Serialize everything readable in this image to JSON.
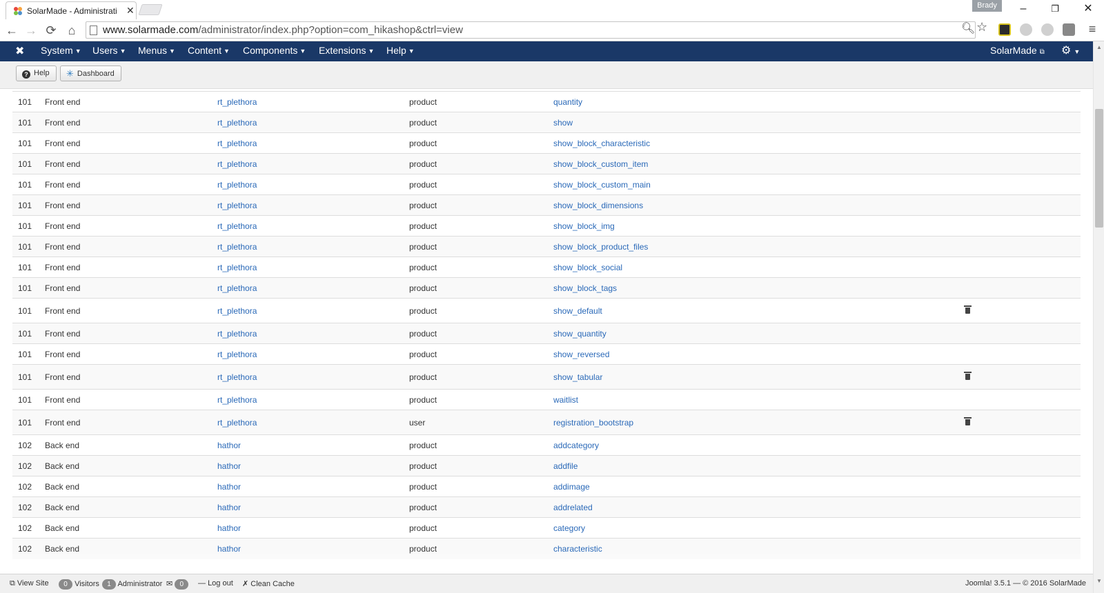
{
  "browser": {
    "tab_title": "SolarMade - Administratio",
    "profile_name": "Brady",
    "url_host": "www.solarmade.com",
    "url_path": "/administrator/index.php?option=com_hikashop&ctrl=view"
  },
  "adminbar": {
    "menu": [
      {
        "label": "System"
      },
      {
        "label": "Users"
      },
      {
        "label": "Menus"
      },
      {
        "label": "Content"
      },
      {
        "label": "Components"
      },
      {
        "label": "Extensions"
      },
      {
        "label": "Help"
      }
    ],
    "site_name": "SolarMade",
    "bg_color": "#1a3867"
  },
  "toolbar": {
    "help_label": "Help",
    "dashboard_label": "Dashboard"
  },
  "table": {
    "rows": [
      {
        "id": "101",
        "client": "Front end",
        "template": "rt_plethora",
        "type": "product",
        "file": "quantity",
        "delete": false
      },
      {
        "id": "101",
        "client": "Front end",
        "template": "rt_plethora",
        "type": "product",
        "file": "show",
        "delete": false
      },
      {
        "id": "101",
        "client": "Front end",
        "template": "rt_plethora",
        "type": "product",
        "file": "show_block_characteristic",
        "delete": false
      },
      {
        "id": "101",
        "client": "Front end",
        "template": "rt_plethora",
        "type": "product",
        "file": "show_block_custom_item",
        "delete": false
      },
      {
        "id": "101",
        "client": "Front end",
        "template": "rt_plethora",
        "type": "product",
        "file": "show_block_custom_main",
        "delete": false
      },
      {
        "id": "101",
        "client": "Front end",
        "template": "rt_plethora",
        "type": "product",
        "file": "show_block_dimensions",
        "delete": false
      },
      {
        "id": "101",
        "client": "Front end",
        "template": "rt_plethora",
        "type": "product",
        "file": "show_block_img",
        "delete": false
      },
      {
        "id": "101",
        "client": "Front end",
        "template": "rt_plethora",
        "type": "product",
        "file": "show_block_product_files",
        "delete": false
      },
      {
        "id": "101",
        "client": "Front end",
        "template": "rt_plethora",
        "type": "product",
        "file": "show_block_social",
        "delete": false
      },
      {
        "id": "101",
        "client": "Front end",
        "template": "rt_plethora",
        "type": "product",
        "file": "show_block_tags",
        "delete": false
      },
      {
        "id": "101",
        "client": "Front end",
        "template": "rt_plethora",
        "type": "product",
        "file": "show_default",
        "delete": true
      },
      {
        "id": "101",
        "client": "Front end",
        "template": "rt_plethora",
        "type": "product",
        "file": "show_quantity",
        "delete": false
      },
      {
        "id": "101",
        "client": "Front end",
        "template": "rt_plethora",
        "type": "product",
        "file": "show_reversed",
        "delete": false
      },
      {
        "id": "101",
        "client": "Front end",
        "template": "rt_plethora",
        "type": "product",
        "file": "show_tabular",
        "delete": true
      },
      {
        "id": "101",
        "client": "Front end",
        "template": "rt_plethora",
        "type": "product",
        "file": "waitlist",
        "delete": false
      },
      {
        "id": "101",
        "client": "Front end",
        "template": "rt_plethora",
        "type": "user",
        "file": "registration_bootstrap",
        "delete": true
      },
      {
        "id": "102",
        "client": "Back end",
        "template": "hathor",
        "type": "product",
        "file": "addcategory",
        "delete": false
      },
      {
        "id": "102",
        "client": "Back end",
        "template": "hathor",
        "type": "product",
        "file": "addfile",
        "delete": false
      },
      {
        "id": "102",
        "client": "Back end",
        "template": "hathor",
        "type": "product",
        "file": "addimage",
        "delete": false
      },
      {
        "id": "102",
        "client": "Back end",
        "template": "hathor",
        "type": "product",
        "file": "addrelated",
        "delete": false
      },
      {
        "id": "102",
        "client": "Back end",
        "template": "hathor",
        "type": "product",
        "file": "category",
        "delete": false
      },
      {
        "id": "102",
        "client": "Back end",
        "template": "hathor",
        "type": "product",
        "file": "characteristic",
        "delete": false
      }
    ]
  },
  "statusbar": {
    "view_site": "View Site",
    "visitors_count": "0",
    "visitors_label": "Visitors",
    "admin_count": "1",
    "admin_label": "Administrator",
    "messages_count": "0",
    "logout_label": "Log out",
    "clean_cache_label": "Clean Cache",
    "footer_text": "Joomla! 3.5.1 — © 2016 SolarMade"
  }
}
